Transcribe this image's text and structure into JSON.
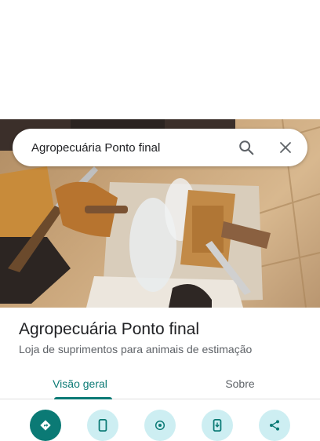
{
  "search": {
    "query": "Agropecuária Ponto final",
    "search_icon": "search-icon",
    "close_icon": "close-icon"
  },
  "place": {
    "name": "Agropecuária Ponto final",
    "category": "Loja de suprimentos para animais de estimação"
  },
  "tabs": [
    {
      "label": "Visão geral",
      "active": true
    },
    {
      "label": "Sobre",
      "active": false
    }
  ],
  "actions": [
    {
      "icon": "directions-icon"
    },
    {
      "icon": "phone-icon"
    },
    {
      "icon": "location-icon"
    },
    {
      "icon": "save-to-phone-icon"
    },
    {
      "icon": "share-icon"
    }
  ],
  "colors": {
    "accent": "#0b7a75",
    "action_bg": "#cdeef2"
  }
}
